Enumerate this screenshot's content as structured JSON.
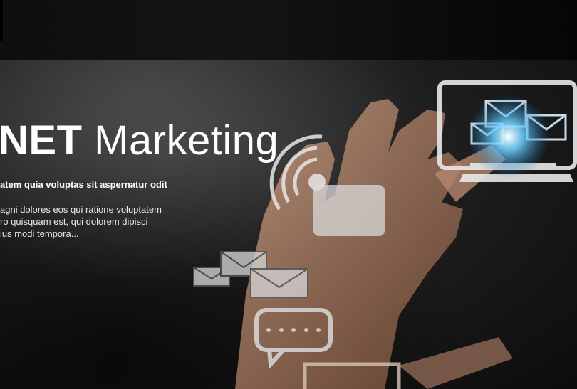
{
  "hero": {
    "title_bold": "NET",
    "title_light": "Marketing",
    "subtitle": "atem quia voluptas sit aspernatur odit",
    "description_lines": [
      "agni dolores eos qui ratione voluptatem",
      "ro quisquam est, qui dolorem dipisci",
      "ius modi tempora..."
    ]
  },
  "icons": [
    "wifi-icon",
    "mail-icon",
    "chat-bubble-icon",
    "monitor-icon"
  ],
  "colors": {
    "glow": "#6fd0ff",
    "background": "#1a1a1a",
    "text": "#ffffff"
  }
}
